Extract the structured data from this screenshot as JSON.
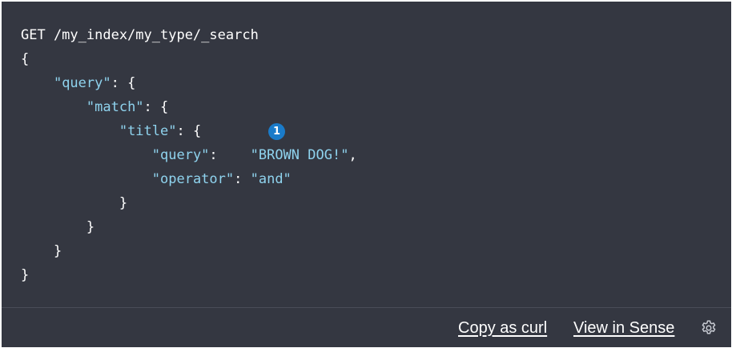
{
  "code": {
    "lines": [
      {
        "indent": "",
        "a": "GET /my_index/my_type/_search",
        "b": "",
        "c": ""
      },
      {
        "indent": "",
        "a": "{",
        "b": "",
        "c": ""
      },
      {
        "indent": "    ",
        "a": "\"query\"",
        "b": ": {",
        "c": ""
      },
      {
        "indent": "        ",
        "a": "\"match\"",
        "b": ": {",
        "c": ""
      },
      {
        "indent": "            ",
        "a": "\"title\"",
        "b": ": {",
        "c": ""
      },
      {
        "indent": "                ",
        "a": "\"query\"",
        "b": ":    ",
        "c": "\"BROWN DOG!\"",
        "d": ","
      },
      {
        "indent": "                ",
        "a": "\"operator\"",
        "b": ": ",
        "c": "\"and\"",
        "d": ""
      },
      {
        "indent": "            ",
        "a": "}",
        "b": "",
        "c": ""
      },
      {
        "indent": "        ",
        "a": "}",
        "b": "",
        "c": ""
      },
      {
        "indent": "    ",
        "a": "}",
        "b": "",
        "c": ""
      },
      {
        "indent": "",
        "a": "}",
        "b": "",
        "c": ""
      }
    ],
    "callout_number": "1"
  },
  "footer": {
    "copy_as_curl": "Copy as curl",
    "view_in_sense": "View in Sense"
  },
  "icons": {
    "settings": "gear-icon"
  },
  "colors": {
    "panel_background": "#343741",
    "key_color": "#8fd3ee",
    "callout_color": "#1a7bc9"
  }
}
